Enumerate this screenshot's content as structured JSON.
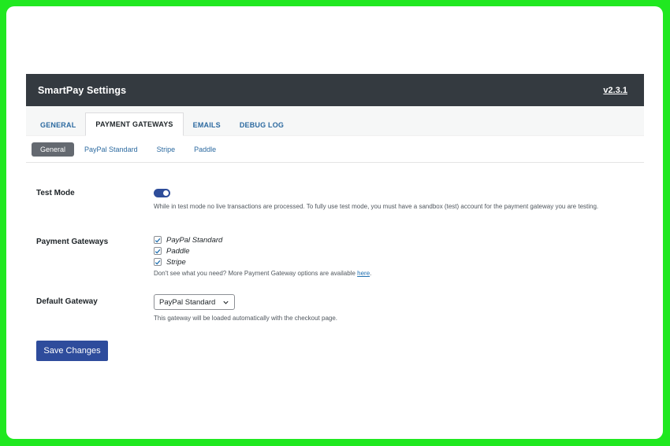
{
  "header": {
    "title": "SmartPay Settings",
    "version": "v2.3.1"
  },
  "tabs": [
    {
      "label": "GENERAL",
      "active": false
    },
    {
      "label": "PAYMENT GATEWAYS",
      "active": true
    },
    {
      "label": "EMAILS",
      "active": false
    },
    {
      "label": "DEBUG LOG",
      "active": false
    }
  ],
  "subtabs": [
    {
      "label": "General",
      "active": true
    },
    {
      "label": "PayPal Standard",
      "active": false
    },
    {
      "label": "Stripe",
      "active": false
    },
    {
      "label": "Paddle",
      "active": false
    }
  ],
  "test_mode": {
    "label": "Test Mode",
    "enabled": true,
    "description": "While in test mode no live transactions are processed. To fully use test mode, you must have a sandbox (test) account for the payment gateway you are testing."
  },
  "payment_gateways": {
    "label": "Payment Gateways",
    "options": [
      {
        "label": "PayPal Standard",
        "checked": true
      },
      {
        "label": "Paddle",
        "checked": true
      },
      {
        "label": "Stripe",
        "checked": true
      }
    ],
    "note_prefix": "Don't see what you need? More Payment Gateway options are available ",
    "note_link": "here",
    "note_suffix": "."
  },
  "default_gateway": {
    "label": "Default Gateway",
    "selected": "PayPal Standard",
    "description": "This gateway will be loaded automatically with the checkout page."
  },
  "actions": {
    "save_label": "Save Changes"
  },
  "icons": {
    "check": "checkmark-icon",
    "chevron": "chevron-down-icon"
  },
  "colors": {
    "header_bg": "#343a40",
    "accent": "#2e4c9c",
    "link": "#2c6aa0",
    "frame_border": "#20e820"
  }
}
